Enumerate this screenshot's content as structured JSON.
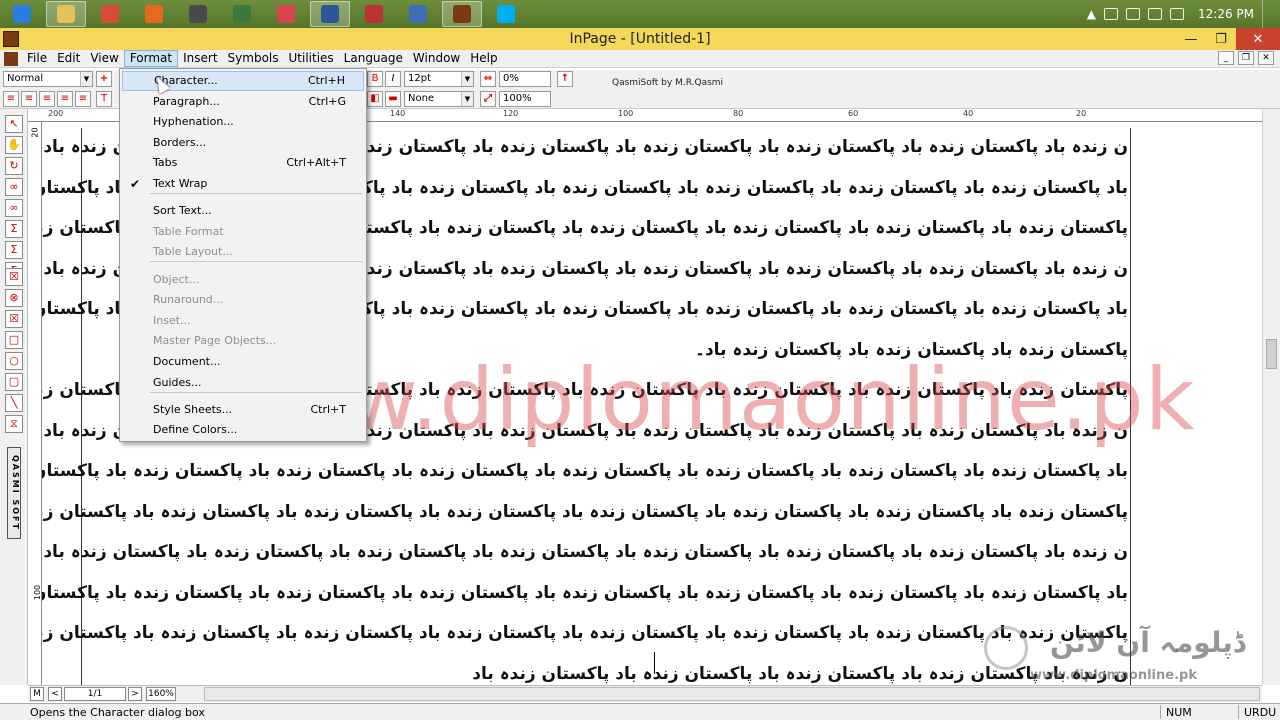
{
  "taskbar": {
    "apps": [
      {
        "name": "ie-icon",
        "color": "#2a7de1",
        "active": false
      },
      {
        "name": "explorer-icon",
        "color": "#e5c15a",
        "active": true
      },
      {
        "name": "chrome-icon",
        "color": "#d84b3b",
        "active": false
      },
      {
        "name": "firefox-icon",
        "color": "#e46a1e",
        "active": false
      },
      {
        "name": "app-icon-5",
        "color": "#4a4a4a",
        "active": false
      },
      {
        "name": "app-icon-6",
        "color": "#3c7a3c",
        "active": false
      },
      {
        "name": "app-icon-7",
        "color": "#d9434c",
        "active": false
      },
      {
        "name": "word-icon",
        "color": "#2b5797",
        "active": true
      },
      {
        "name": "app-icon-9",
        "color": "#b33",
        "active": false
      },
      {
        "name": "app-icon-10",
        "color": "#3d6fb5",
        "active": false
      },
      {
        "name": "inpage-icon",
        "color": "#7a3b12",
        "active": true
      },
      {
        "name": "skype-icon",
        "color": "#00aff0",
        "active": false
      }
    ],
    "clock": "12:26 PM"
  },
  "titlebar": {
    "title": "InPage - [Untitled-1]",
    "minimize": "—",
    "maximize": "❐",
    "close": "✕"
  },
  "menu": {
    "items": [
      "File",
      "Edit",
      "View",
      "Format",
      "Insert",
      "Symbols",
      "Utilities",
      "Language",
      "Window",
      "Help"
    ],
    "active": "Format"
  },
  "toolbar": {
    "style_value": "Normal",
    "font_size": "12pt",
    "tracking": "0%",
    "underline": "None",
    "scale": "100%",
    "credit": "QasmiSoft by M.R.Qasmi",
    "bold": "B",
    "italic": "I"
  },
  "ruler": {
    "labels": [
      "200",
      "140",
      "120",
      "100",
      "80",
      "60",
      "40",
      "20"
    ]
  },
  "vruler": {
    "labels": [
      "20",
      "100"
    ]
  },
  "palette": {
    "brand": "QASMI SOFT"
  },
  "format_menu": {
    "items": [
      {
        "label": "Character...",
        "shortcut": "Ctrl+H",
        "disabled": false,
        "hover": true
      },
      {
        "label": "Paragraph...",
        "shortcut": "Ctrl+G",
        "disabled": false
      },
      {
        "label": "Hyphenation...",
        "shortcut": "",
        "disabled": false
      },
      {
        "label": "Borders...",
        "shortcut": "",
        "disabled": false
      },
      {
        "label": "Tabs",
        "shortcut": "Ctrl+Alt+T",
        "disabled": false
      },
      {
        "label": "Text Wrap",
        "shortcut": "",
        "disabled": false,
        "checked": true
      },
      {
        "label": "Sort Text...",
        "shortcut": "",
        "disabled": false
      },
      {
        "label": "Table Format",
        "shortcut": "",
        "disabled": true
      },
      {
        "label": "Table Layout...",
        "shortcut": "",
        "disabled": true
      },
      {
        "label": "Object...",
        "shortcut": "",
        "disabled": true
      },
      {
        "label": "Runaround...",
        "shortcut": "",
        "disabled": true
      },
      {
        "label": "Inset...",
        "shortcut": "",
        "disabled": true
      },
      {
        "label": "Master Page Objects...",
        "shortcut": "",
        "disabled": true
      },
      {
        "label": "Document...",
        "shortcut": "",
        "disabled": false
      },
      {
        "label": "Guides...",
        "shortcut": "",
        "disabled": false
      },
      {
        "label": "Style Sheets...",
        "shortcut": "Ctrl+T",
        "disabled": false
      },
      {
        "label": "Define Colors...",
        "shortcut": "",
        "disabled": false
      }
    ]
  },
  "document": {
    "lines": [
      "ن زندہ باد پاکستان زندہ باد پاکستان زندہ باد پاکستان زندہ باد پاکستان زندہ باد پاکستان زندہ باد پاکستان زندہ باد پاکستان زندہ باد پاکستان زندہ",
      "باد پاکستان زندہ باد پاکستان زندہ باد پاکستان زندہ باد پاکستان زندہ باد پاکستان زندہ باد پاکستان زندہ باد پاکستان زندہ باد پاکستان زندہ باد",
      "پاکستان زندہ باد پاکستان زندہ باد پاکستان زندہ باد پاکستان زندہ باد پاکستان زندہ باد پاکستان زندہ باد پاکستان زندہ باد پاکستان زندہ باد پاکستا",
      "ن زندہ باد پاکستان زندہ باد پاکستان زندہ باد پاکستان زندہ باد پاکستان زندہ باد پاکستان زندہ باد پاکستان زندہ باد پاکستان زندہ باد پاکستان زندہ",
      "باد پاکستان زندہ باد پاکستان زندہ باد پاکستان زندہ باد پاکستان زندہ باد پاکستان زندہ باد پاکستان زندہ باد پاکستان زندہ باد پاکستان زندہ باد",
      "پاکستان زندہ باد پاکستان زندہ باد پاکستان زندہ باد۔",
      "پاکستان زندہ باد پاکستان زندہ باد پاکستان زندہ باد پاکستان زندہ باد پاکستان زندہ باد پاکستان زندہ باد پاکستان زندہ باد پاکستان زندہ باد پاکستا",
      "ن زندہ باد پاکستان زندہ باد پاکستان زندہ باد پاکستان زندہ باد پاکستان زندہ باد پاکستان زندہ باد پاکستان زندہ باد پاکستان زندہ باد پاکستان زندہ",
      "باد پاکستان زندہ باد پاکستان زندہ باد پاکستان زندہ باد پاکستان زندہ باد پاکستان زندہ باد پاکستان زندہ باد پاکستان زندہ باد پاکستان زندہ باد",
      "پاکستان زندہ باد پاکستان زندہ باد پاکستان زندہ باد پاکستان زندہ باد پاکستان زندہ باد پاکستان زندہ باد پاکستان زندہ باد پاکستان زندہ باد پاکستا",
      "ن زندہ باد پاکستان زندہ باد پاکستان زندہ باد پاکستان زندہ باد پاکستان زندہ باد پاکستان زندہ باد پاکستان زندہ باد پاکستان زندہ باد پاکستان زندہ",
      "باد پاکستان زندہ باد پاکستان زندہ باد پاکستان زندہ باد پاکستان زندہ باد پاکستان زندہ باد پاکستان زندہ باد پاکستان زندہ باد پاکستان زندہ باد",
      "پاکستان زندہ باد پاکستان زندہ باد پاکستان زندہ باد پاکستان زندہ باد پاکستان زندہ باد پاکستان زندہ باد پاکستان زندہ باد پاکستان زندہ باد پاکستا",
      "ن زندہ باد پاکستان زندہ باد پاکستان زندہ باد پاکستان زندہ باد پاکستان زندہ باد"
    ]
  },
  "watermark": {
    "text": "www.diplomaonline.pk",
    "logo_urdu": "ڈپلومہ آن لائن",
    "logo_url": "www.diplomaonline.pk"
  },
  "navbar": {
    "page": "1/1",
    "zoom": "160%",
    "master": "M",
    "prev": "<",
    "next": ">"
  },
  "status": {
    "text": "Opens the Character dialog box",
    "num": "NUM",
    "lang": "URDU"
  }
}
